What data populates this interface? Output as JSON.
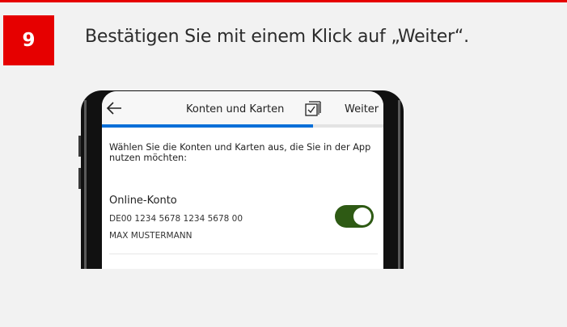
{
  "step": {
    "number": "9",
    "instruction": "Bestätigen Sie mit einem Klick auf „Weiter“."
  },
  "colors": {
    "brand_red": "#e60000",
    "progress_blue": "#0a6fd8",
    "toggle_green": "#2e5a14"
  },
  "app": {
    "back_icon": "arrow-left-icon",
    "title": "Konten und Karten",
    "select_all_icon": "select-all-checkbox-icon",
    "next_label": "Weiter",
    "progress": 0.75,
    "intro": "Wählen Sie die Konten und Karten aus, die Sie in der App nutzen möchten:",
    "accounts": [
      {
        "name": "Online-Konto",
        "iban": "DE00 1234 5678 1234 5678 00",
        "holder": "MAX MUSTERMANN",
        "enabled": true
      }
    ]
  }
}
